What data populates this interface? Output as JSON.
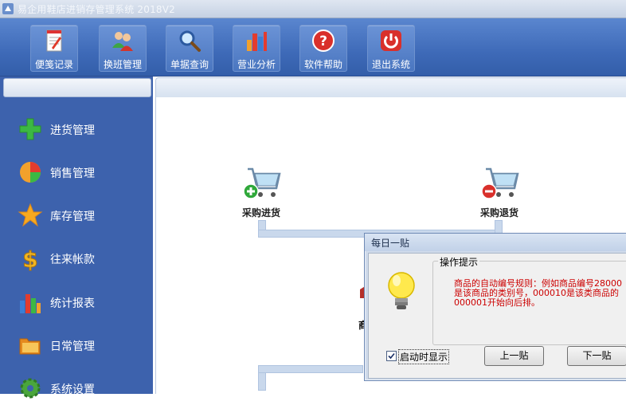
{
  "window": {
    "title": "易企用鞋店进销存管理系统 2018V2"
  },
  "toolbar": {
    "buttons": [
      {
        "label": "便笺记录",
        "icon": "notepad-icon"
      },
      {
        "label": "换班管理",
        "icon": "users-icon"
      },
      {
        "label": "单据查询",
        "icon": "magnifier-icon"
      },
      {
        "label": "营业分析",
        "icon": "bar-chart-icon"
      },
      {
        "label": "软件帮助",
        "icon": "help-icon"
      },
      {
        "label": "退出系统",
        "icon": "power-icon"
      }
    ]
  },
  "sidebar": {
    "items": [
      {
        "label": "进货管理",
        "icon": "plus-icon"
      },
      {
        "label": "销售管理",
        "icon": "pie-chart-icon"
      },
      {
        "label": "库存管理",
        "icon": "star-icon"
      },
      {
        "label": "往来帐款",
        "icon": "dollar-icon"
      },
      {
        "label": "统计报表",
        "icon": "bar-chart-icon"
      },
      {
        "label": "日常管理",
        "icon": "folder-icon"
      },
      {
        "label": "系统设置",
        "icon": "gear-icon"
      }
    ]
  },
  "flow": {
    "purchase_in": "采购进货",
    "purchase_return": "采购退货",
    "partial_label": "商"
  },
  "dialog": {
    "title": "每日一贴",
    "group_title": "操作提示",
    "tip_lines": [
      "商品的自动编号规则：例如商品编号28000",
      "是该商品的类别号，000010是该类商品的",
      "000001开始向后排。"
    ],
    "checkbox_label": "启动时显示",
    "checkbox_checked": true,
    "prev_button": "上一贴",
    "next_button": "下一贴"
  },
  "colors": {
    "toolbar_blue": "#3e6ab8",
    "sidebar_blue": "#3d62ad",
    "tip_red": "#cc0000"
  }
}
